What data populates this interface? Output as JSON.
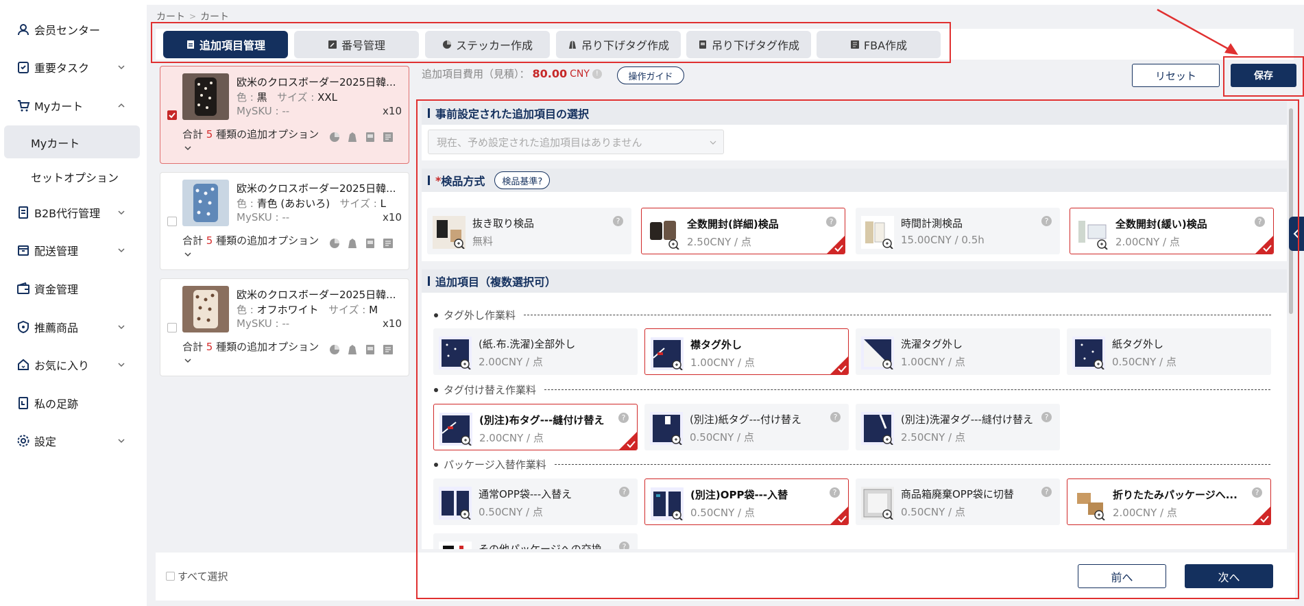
{
  "sidebar": {
    "items": [
      {
        "label": "会员センター",
        "icon": "user-icon"
      },
      {
        "label": "重要タスク",
        "icon": "task-icon"
      },
      {
        "label": "Myカート",
        "icon": "cart-icon"
      },
      {
        "label": "Myカート"
      },
      {
        "label": "セットオプション"
      },
      {
        "label": "B2B代行管理",
        "icon": "document-icon"
      },
      {
        "label": "配送管理",
        "icon": "box-icon"
      },
      {
        "label": "資金管理",
        "icon": "wallet-icon"
      },
      {
        "label": "推薦商品",
        "icon": "shield-icon"
      },
      {
        "label": "お気に入り",
        "icon": "house-icon"
      },
      {
        "label": "私の足跡",
        "icon": "footprint-icon"
      },
      {
        "label": "設定",
        "icon": "gear-icon"
      }
    ]
  },
  "breadcrumb": {
    "first": "カート",
    "sep": ">",
    "second": "カート"
  },
  "tabs": [
    {
      "label": "追加項目管理",
      "active": true
    },
    {
      "label": "番号管理"
    },
    {
      "label": "ステッカー作成"
    },
    {
      "label": "吊り下げタグ作成"
    },
    {
      "label": "吊り下げタグ作成"
    },
    {
      "label": "FBA作成"
    }
  ],
  "products": [
    {
      "name": "欧米のクロスボーダー2025日韓...",
      "color_label": "色 :",
      "color": "黒",
      "size_label": "サイズ :",
      "size": "XXL",
      "sku_label": "MySKU :",
      "sku": "--",
      "qty": "x10",
      "total_prefix": "合計",
      "total_num": "5",
      "total_suffix": "種類の追加オプション"
    },
    {
      "name": "欧米のクロスボーダー2025日韓...",
      "color_label": "色 :",
      "color": "青色 (あおいろ)",
      "size_label": "サイズ :",
      "size": "L",
      "sku_label": "MySKU :",
      "sku": "--",
      "qty": "x10",
      "total_prefix": "合計",
      "total_num": "5",
      "total_suffix": "種類の追加オプション"
    },
    {
      "name": "欧米のクロスボーダー2025日韓...",
      "color_label": "色 :",
      "color": "オフホワイト",
      "size_label": "サイズ :",
      "size": "M",
      "sku_label": "MySKU :",
      "sku": "--",
      "qty": "x10",
      "total_prefix": "合計",
      "total_num": "5",
      "total_suffix": "種類の追加オプション"
    }
  ],
  "fee": {
    "label": "追加項目費用（見積）：",
    "amount": "80.00",
    "currency": "CNY",
    "help": "!"
  },
  "buttons": {
    "guide": "操作ガイド",
    "reset": "リセット",
    "save": "保存",
    "prev": "前へ",
    "next": "次へ",
    "select_all": "すべて選択"
  },
  "preset": {
    "title": "事前設定された追加項目の選択",
    "placeholder": "現在、予め設定された追加項目はありません"
  },
  "inspection": {
    "required_mark": "*",
    "title": "検品方式",
    "criteria": "検品基準?",
    "options": [
      {
        "name": "抜き取り検品",
        "price": "無料"
      },
      {
        "name": "全数開封(詳細)検品",
        "price": "2.50CNY / 点"
      },
      {
        "name": "時間計測検品",
        "price": "15.00CNY / 0.5h"
      },
      {
        "name": "全数開封(緩い)検品",
        "price": "2.00CNY / 点"
      }
    ]
  },
  "additional": {
    "title": "追加項目（複数選択可）",
    "groups": [
      {
        "title": "タグ外し作業料",
        "options": [
          {
            "name": "(紙.布.洗濯)全部外し",
            "price": "2.00CNY / 点"
          },
          {
            "name": "襟タグ外し",
            "price": "1.00CNY / 点"
          },
          {
            "name": "洗濯タグ外し",
            "price": "1.00CNY / 点"
          },
          {
            "name": "紙タグ外し",
            "price": "0.50CNY / 点"
          }
        ]
      },
      {
        "title": "タグ付け替え作業料",
        "options": [
          {
            "name": "(別注)布タグ---縫付け替え",
            "price": "2.00CNY / 点"
          },
          {
            "name": "(別注)紙タグ---付け替え",
            "price": "0.50CNY / 点"
          },
          {
            "name": "(別注)洗濯タグ---縫付け替え",
            "price": "2.50CNY / 点"
          }
        ]
      },
      {
        "title": "パッケージ入替作業料",
        "options": [
          {
            "name": "通常OPP袋---入替え",
            "price": "0.50CNY / 点"
          },
          {
            "name": "(別注)OPP袋---入替",
            "price": "0.50CNY / 点"
          },
          {
            "name": "商品箱廃棄OPP袋に切替",
            "price": "0.50CNY / 点"
          },
          {
            "name": "折りたたみパッケージへ...",
            "price": "2.00CNY / 点"
          },
          {
            "name": "その他パッケージへの交換",
            "price": ""
          }
        ]
      }
    ]
  },
  "colors": {
    "primary": "#14305e",
    "accent_red": "#c62828",
    "selected_border": "#d02727"
  }
}
